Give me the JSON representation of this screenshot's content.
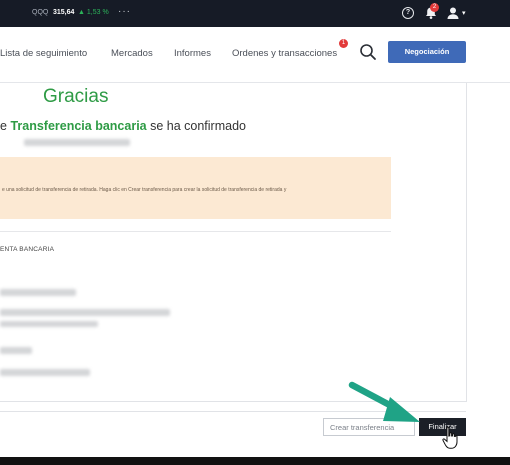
{
  "ticker": {
    "symbol": "QQQ",
    "price": "315,64",
    "change": "▲ 1,53 %",
    "more": "···",
    "notifications_badge": "2",
    "help_icon": "question-circle-icon",
    "bell_icon": "bell-icon",
    "user_icon": "user-icon"
  },
  "nav": {
    "watchlist": "Lista de seguimiento",
    "markets": "Mercados",
    "reports": "Informes",
    "orders": "Ordenes y transacciones",
    "orders_badge": "1",
    "search_icon": "search-icon",
    "trade_button": "Negociación"
  },
  "confirmation": {
    "heading": "Gracias",
    "prefix": "e ",
    "method": "Transferencia bancaria",
    "suffix": " se ha confirmado"
  },
  "notice": {
    "text": "e una solicitud de transferencia de retirada. Haga clic en Crear transferencia para crear la solicitud de transferencia de retirada y"
  },
  "bank_section": {
    "title": "ENTA BANCARIA"
  },
  "footer": {
    "create_button": "Crear transferencia",
    "finish_button": "Finalizar"
  },
  "colors": {
    "accent_green": "#2e9b45",
    "primary_blue": "#3f6ab8",
    "notice_bg": "#fce9d3",
    "badge_red": "#e23a3a",
    "annotation_arrow": "#1fa386"
  }
}
